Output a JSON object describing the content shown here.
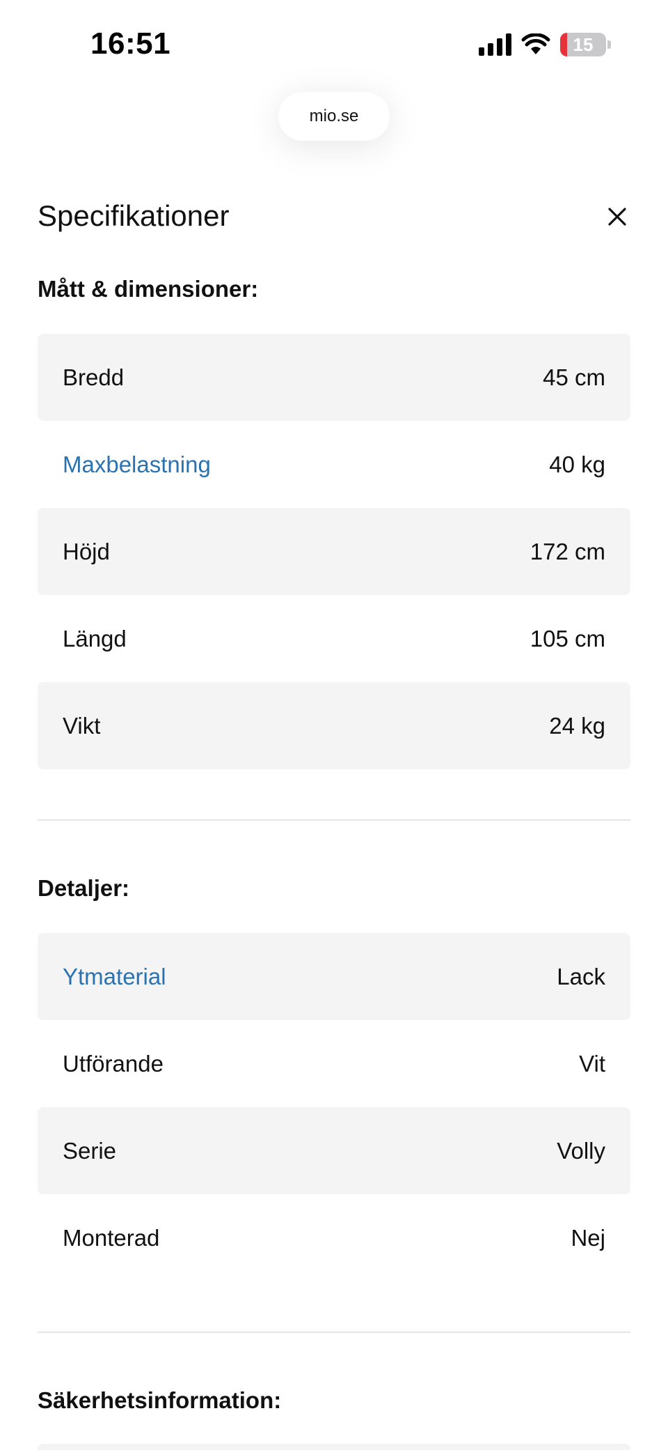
{
  "status_bar": {
    "time": "16:51",
    "battery": "15"
  },
  "browser": {
    "url": "mio.se"
  },
  "sheet": {
    "title": "Specifikationer"
  },
  "sections": [
    {
      "heading": "Mått & dimensioner:",
      "rows": [
        {
          "label": "Bredd",
          "value": "45 cm"
        },
        {
          "label": "Maxbelastning",
          "value": "40 kg"
        },
        {
          "label": "Höjd",
          "value": "172 cm"
        },
        {
          "label": "Längd",
          "value": "105 cm"
        },
        {
          "label": "Vikt",
          "value": "24 kg"
        }
      ]
    },
    {
      "heading": "Detaljer:",
      "rows": [
        {
          "label": "Ytmaterial",
          "value": "Lack"
        },
        {
          "label": "Utförande",
          "value": "Vit"
        },
        {
          "label": "Serie",
          "value": "Volly"
        },
        {
          "label": "Monterad",
          "value": "Nej"
        }
      ]
    },
    {
      "heading": "Säkerhetsinformation:"
    }
  ],
  "colors": {
    "link": "#2b72b0",
    "row_shade": "#f4f4f4",
    "battery_low": "#e5323b"
  }
}
